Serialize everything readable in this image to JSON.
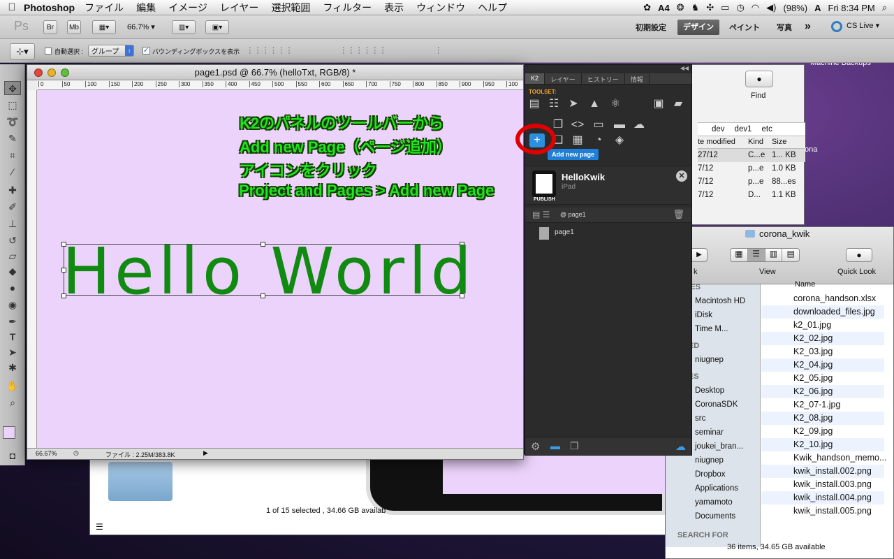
{
  "menubar": {
    "app": "Photoshop",
    "items": [
      "ファイル",
      "編集",
      "イメージ",
      "レイヤー",
      "選択範囲",
      "フィルター",
      "表示",
      "ウィンドウ",
      "ヘルプ"
    ],
    "adobe_badge": "4",
    "battery": "(98%)",
    "clock": "Fri 8:34 PM"
  },
  "appbar": {
    "ps_logo": "Ps",
    "br": "Br",
    "mb": "Mb",
    "zoom": "66.7%",
    "workspaces": [
      "初期設定",
      "デザイン",
      "ペイント",
      "写真"
    ],
    "active_workspace": "デザイン",
    "cs_live": "CS Live"
  },
  "options": {
    "auto_select_label": "自動選択 :",
    "auto_select_value": "グループ",
    "bounding_box_label": "バウンディングボックスを表示"
  },
  "document": {
    "title": "page1.psd @ 66.7% (helloTxt, RGB/8) *",
    "ruler_ticks": [
      "0",
      "50",
      "100",
      "150",
      "200",
      "250",
      "300",
      "350",
      "400",
      "450",
      "500",
      "550",
      "600",
      "650",
      "700",
      "750",
      "800",
      "850",
      "900",
      "950",
      "100"
    ],
    "text": "Hello World",
    "status_zoom": "66.67%",
    "status_file": "ファイル : 2.25M/383.8K"
  },
  "annotation": {
    "lines": [
      "K2のパネルのツールバーから",
      "Add new Page（ページ追加）",
      "アイコンをクリック",
      "Project and Pages > Add new Page"
    ]
  },
  "k2": {
    "tabs": [
      "K2",
      "レイヤー",
      "ヒストリー",
      "情報"
    ],
    "toolset_label": "TOOLSET:",
    "tooltip": "Add new page",
    "project_name": "HelloKwik",
    "device": "iPad",
    "publish": "PUBLISH",
    "current_page": "@ page1",
    "pages": [
      "page1"
    ],
    "accent_color": "#f5a623",
    "highlight_color": "#e00000"
  },
  "finder_back": {
    "find_label": "Find",
    "path": [
      "dev",
      "dev1",
      "etc"
    ],
    "columns": [
      "te modified",
      "Kind",
      "Size"
    ],
    "rows": [
      {
        "date": "27/12",
        "kind": "C...e",
        "size": "1... KB"
      },
      {
        "date": "7/12",
        "kind": "p...e",
        "size": "1.0 KB"
      },
      {
        "date": "7/12",
        "kind": "p...e",
        "size": "88...es"
      },
      {
        "date": "7/12",
        "kind": "D...",
        "size": "1.1 KB"
      }
    ],
    "peek_text": "ona",
    "desktop_label": "Machine Backups",
    "status": "1 of 15 selected , 34.66 GB availab"
  },
  "finder": {
    "title": "corona_kwik",
    "toolbar_labels": [
      "k",
      "View",
      "Quick Look"
    ],
    "sidebar": {
      "devices_header": "VICES",
      "devices": [
        "Macintosh HD",
        "iDisk",
        "Time M..."
      ],
      "shared_header": "ARED",
      "shared": [
        "niugnep"
      ],
      "places_header": "ACES",
      "places": [
        "Desktop",
        "CoronaSDK",
        "src",
        "seminar",
        "joukei_bran...",
        "niugnep",
        "Dropbox",
        "Applications",
        "yamamoto",
        "Documents"
      ],
      "search_header": "SEARCH FOR"
    },
    "column_header": "Name",
    "files": [
      "corona_handson.xlsx",
      "downloaded_files.jpg",
      "k2_01.jpg",
      "K2_02.jpg",
      "K2_03.jpg",
      "K2_04.jpg",
      "K2_05.jpg",
      "K2_06.jpg",
      "K2_07-1.jpg",
      "K2_08.jpg",
      "K2_09.jpg",
      "K2_10.jpg",
      "Kwik_handson_memo...",
      "kwik_install.002.png",
      "kwik_install.003.png",
      "kwik_install.004.png",
      "kwik_install.005.png"
    ],
    "status": "36 items, 34.65 GB available"
  }
}
